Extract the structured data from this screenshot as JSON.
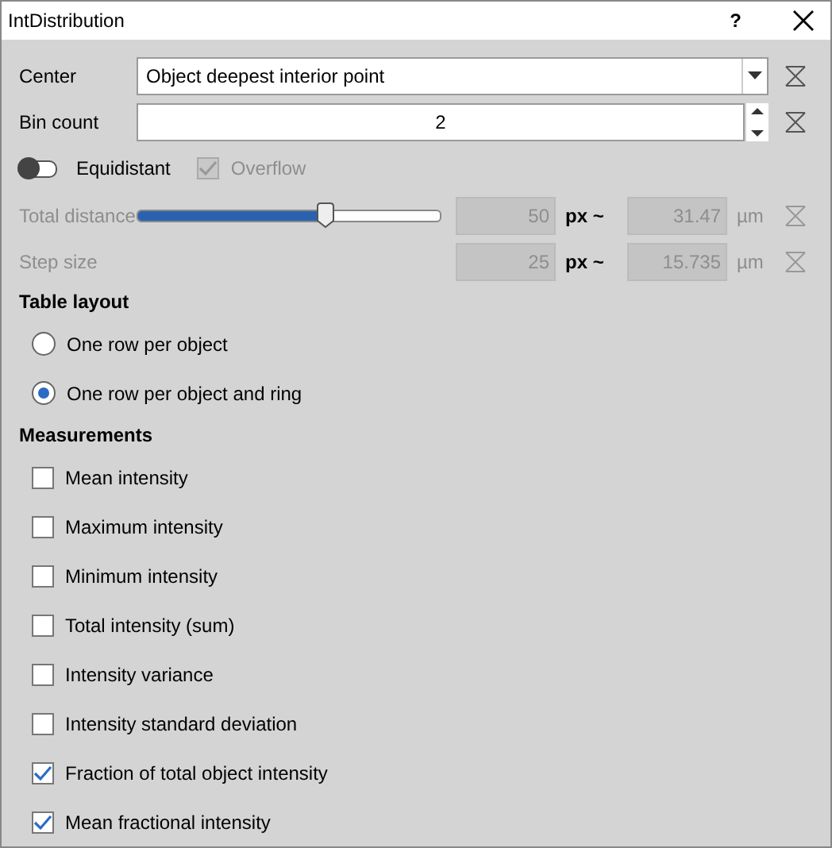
{
  "window": {
    "title": "IntDistribution",
    "help": "?"
  },
  "center": {
    "label": "Center",
    "value": "Object deepest interior point"
  },
  "bin_count": {
    "label": "Bin count",
    "value": "2"
  },
  "equidistant": {
    "label": "Equidistant",
    "on": false
  },
  "overflow": {
    "label": "Overflow",
    "checked": true,
    "disabled": true
  },
  "distances": [
    {
      "kind": "slider",
      "label": "Total distance",
      "level": 0.62,
      "px": "50",
      "px_unit": "px ~",
      "um": "31.47",
      "um_unit": "µm",
      "disabled": true
    },
    {
      "kind": "plain",
      "label": "Step size",
      "px": "25",
      "px_unit": "px ~",
      "um": "15.735",
      "um_unit": "µm",
      "disabled": true
    }
  ],
  "table_layout": {
    "title": "Table layout",
    "options": [
      {
        "label": "One row per object",
        "selected": false
      },
      {
        "label": "One row per object and ring",
        "selected": true
      }
    ]
  },
  "measurements": {
    "title": "Measurements",
    "items": [
      {
        "label": "Mean intensity",
        "checked": false
      },
      {
        "label": "Maximum intensity",
        "checked": false
      },
      {
        "label": "Minimum intensity",
        "checked": false
      },
      {
        "label": "Total intensity (sum)",
        "checked": false
      },
      {
        "label": "Intensity variance",
        "checked": false
      },
      {
        "label": "Intensity standard deviation",
        "checked": false
      },
      {
        "label": "Fraction of total object intensity",
        "checked": true
      },
      {
        "label": "Mean fractional intensity",
        "checked": true
      }
    ]
  }
}
